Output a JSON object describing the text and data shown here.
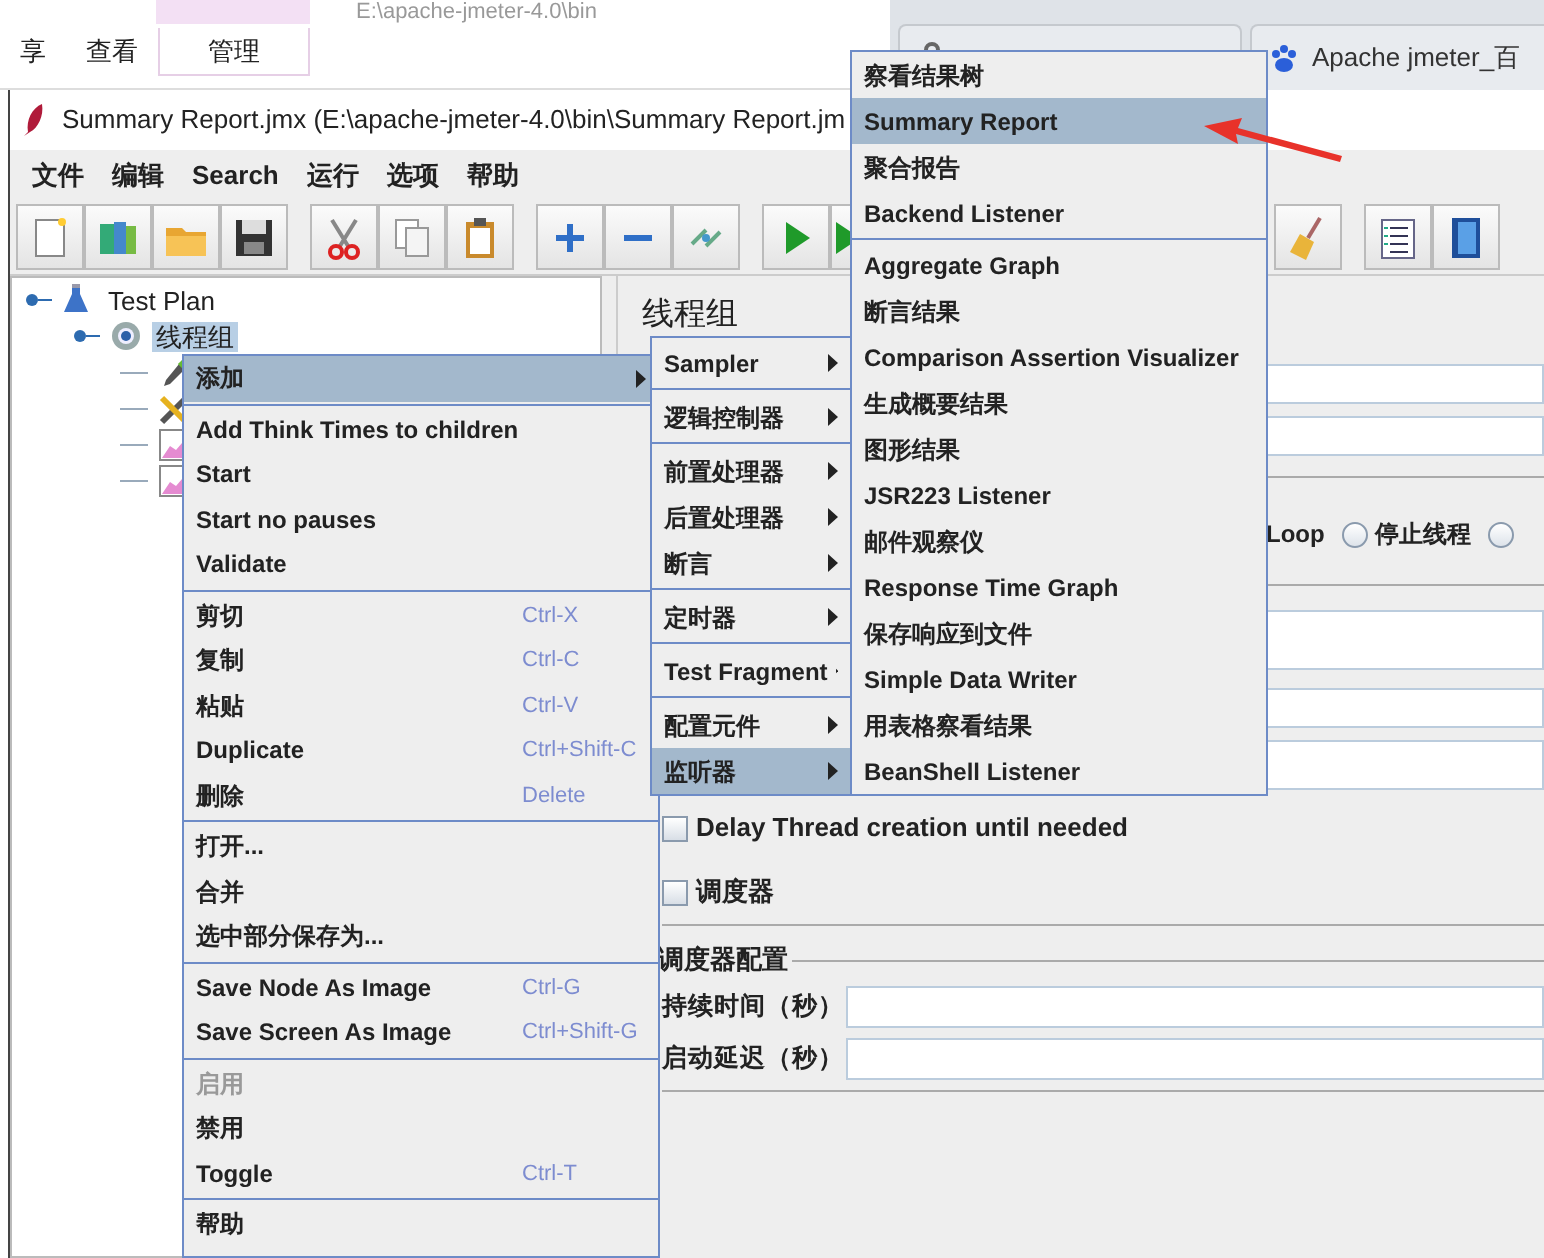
{
  "background": {
    "path": "E:\\apache-jmeter-4.0\\bin",
    "explorer_tabs": [
      {
        "label": "享",
        "selected": false
      },
      {
        "label": "查看",
        "selected": false
      },
      {
        "label": "管理",
        "selected": true
      }
    ],
    "browser_tabs": [
      {
        "selected": false
      },
      {
        "label": "Apache jmeter_百",
        "selected": false
      }
    ]
  },
  "window": {
    "title": "Summary Report.jmx (E:\\apache-jmeter-4.0\\bin\\Summary Report.jm"
  },
  "menu_bar": [
    "文件",
    "编辑",
    "Search",
    "运行",
    "选项",
    "帮助"
  ],
  "tree": [
    {
      "label": "Test Plan",
      "kind": "plan",
      "selected": false,
      "children": [
        {
          "label": "线程组",
          "kind": "thread",
          "selected": true,
          "children": [
            {
              "kind": "dropper"
            },
            {
              "kind": "tools"
            },
            {
              "kind": "graph"
            },
            {
              "kind": "graph"
            }
          ]
        }
      ]
    }
  ],
  "thread_group": {
    "title": "线程组",
    "on_error_options": [
      {
        "label": "Loop",
        "selected": false
      },
      {
        "label": "停止线程",
        "selected": false
      },
      {
        "selected": false
      }
    ],
    "delay_thread": {
      "label": "Delay Thread creation until needed",
      "checked": false
    },
    "scheduler": {
      "label": "调度器",
      "checked": false
    },
    "scheduler_config": {
      "title": "调度器配置",
      "fields": [
        {
          "label": "持续时间（秒）"
        },
        {
          "label": "启动延迟（秒）"
        }
      ]
    }
  },
  "context_menu": [
    {
      "kind": "item",
      "label": "添加",
      "selected": true,
      "disabled": false,
      "submenu": true
    },
    {
      "kind": "separator"
    },
    {
      "kind": "item",
      "label": "Add Think Times to children",
      "selected": false,
      "disabled": false,
      "submenu": false
    },
    {
      "kind": "item",
      "label": "Start",
      "selected": false,
      "disabled": false,
      "submenu": false
    },
    {
      "kind": "item",
      "label": "Start no pauses",
      "selected": false,
      "disabled": false,
      "submenu": false
    },
    {
      "kind": "item",
      "label": "Validate",
      "selected": false,
      "disabled": false,
      "submenu": false
    },
    {
      "kind": "separator"
    },
    {
      "kind": "item",
      "label": "剪切",
      "shortcut": "Ctrl-X",
      "selected": false,
      "disabled": false,
      "submenu": false
    },
    {
      "kind": "item",
      "label": "复制",
      "shortcut": "Ctrl-C",
      "selected": false,
      "disabled": false,
      "submenu": false
    },
    {
      "kind": "item",
      "label": "粘贴",
      "shortcut": "Ctrl-V",
      "selected": false,
      "disabled": false,
      "submenu": false
    },
    {
      "kind": "item",
      "label": "Duplicate",
      "shortcut": "Ctrl+Shift-C",
      "selected": false,
      "disabled": false,
      "submenu": false
    },
    {
      "kind": "item",
      "label": "删除",
      "shortcut": "Delete",
      "selected": false,
      "disabled": false,
      "submenu": false
    },
    {
      "kind": "separator"
    },
    {
      "kind": "item",
      "label": "打开...",
      "selected": false,
      "disabled": false,
      "submenu": false
    },
    {
      "kind": "item",
      "label": "合并",
      "selected": false,
      "disabled": false,
      "submenu": false
    },
    {
      "kind": "item",
      "label": "选中部分保存为...",
      "selected": false,
      "disabled": false,
      "submenu": false
    },
    {
      "kind": "separator"
    },
    {
      "kind": "item",
      "label": "Save Node As Image",
      "shortcut": "Ctrl-G",
      "selected": false,
      "disabled": false,
      "submenu": false
    },
    {
      "kind": "item",
      "label": "Save Screen As Image",
      "shortcut": "Ctrl+Shift-G",
      "selected": false,
      "disabled": false,
      "submenu": false
    },
    {
      "kind": "separator"
    },
    {
      "kind": "item",
      "label": "启用",
      "selected": false,
      "disabled": true,
      "submenu": false
    },
    {
      "kind": "item",
      "label": "禁用",
      "selected": false,
      "disabled": false,
      "submenu": false
    },
    {
      "kind": "item",
      "label": "Toggle",
      "shortcut": "Ctrl-T",
      "selected": false,
      "disabled": false,
      "submenu": false
    },
    {
      "kind": "separator"
    },
    {
      "kind": "item",
      "label": "帮助",
      "selected": false,
      "disabled": false,
      "submenu": false
    }
  ],
  "add_submenu": [
    {
      "kind": "item",
      "label": "Sampler",
      "selected": false,
      "submenu": true
    },
    {
      "kind": "separator"
    },
    {
      "kind": "item",
      "label": "逻辑控制器",
      "selected": false,
      "submenu": true
    },
    {
      "kind": "separator"
    },
    {
      "kind": "item",
      "label": "前置处理器",
      "selected": false,
      "submenu": true
    },
    {
      "kind": "item",
      "label": "后置处理器",
      "selected": false,
      "submenu": true
    },
    {
      "kind": "item",
      "label": "断言",
      "selected": false,
      "submenu": true
    },
    {
      "kind": "separator"
    },
    {
      "kind": "item",
      "label": "定时器",
      "selected": false,
      "submenu": true
    },
    {
      "kind": "separator"
    },
    {
      "kind": "item",
      "label": "Test Fragment",
      "selected": false,
      "submenu": true
    },
    {
      "kind": "separator"
    },
    {
      "kind": "item",
      "label": "配置元件",
      "selected": false,
      "submenu": true
    },
    {
      "kind": "item",
      "label": "监听器",
      "selected": true,
      "submenu": true
    }
  ],
  "listener_submenu": [
    {
      "kind": "item",
      "label": "察看结果树",
      "selected": false,
      "submenu": false
    },
    {
      "kind": "item",
      "label": "Summary Report",
      "selected": true,
      "submenu": false
    },
    {
      "kind": "item",
      "label": "聚合报告",
      "selected": false,
      "submenu": false
    },
    {
      "kind": "item",
      "label": "Backend Listener",
      "selected": false,
      "submenu": false
    },
    {
      "kind": "separator"
    },
    {
      "kind": "item",
      "label": "Aggregate Graph",
      "selected": false,
      "submenu": false
    },
    {
      "kind": "item",
      "label": "断言结果",
      "selected": false,
      "submenu": false
    },
    {
      "kind": "item",
      "label": "Comparison Assertion Visualizer",
      "selected": false,
      "submenu": false
    },
    {
      "kind": "item",
      "label": "生成概要结果",
      "selected": false,
      "submenu": false
    },
    {
      "kind": "item",
      "label": "图形结果",
      "selected": false,
      "submenu": false
    },
    {
      "kind": "item",
      "label": "JSR223 Listener",
      "selected": false,
      "submenu": false
    },
    {
      "kind": "item",
      "label": "邮件观察仪",
      "selected": false,
      "submenu": false
    },
    {
      "kind": "item",
      "label": "Response Time Graph",
      "selected": false,
      "submenu": false
    },
    {
      "kind": "item",
      "label": "保存响应到文件",
      "selected": false,
      "submenu": false
    },
    {
      "kind": "item",
      "label": "Simple Data Writer",
      "selected": false,
      "submenu": false
    },
    {
      "kind": "item",
      "label": "用表格察看结果",
      "selected": false,
      "submenu": false
    },
    {
      "kind": "item",
      "label": "BeanShell Listener",
      "selected": false,
      "submenu": false
    }
  ]
}
